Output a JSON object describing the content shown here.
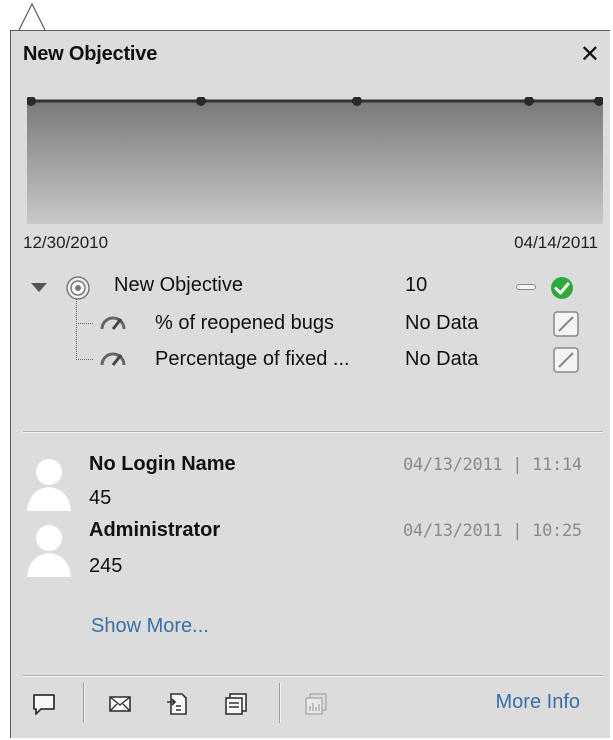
{
  "popup": {
    "title": "New Objective",
    "close_label": "✕"
  },
  "timeline": {
    "start_date": "12/30/2010",
    "end_date": "04/14/2011"
  },
  "objective": {
    "name": "New Objective",
    "value": "10",
    "status": "ok",
    "metrics": [
      {
        "name": "% of reopened bugs",
        "value": "No Data"
      },
      {
        "name": "Percentage of fixed ...",
        "value": "No Data"
      }
    ]
  },
  "activity": [
    {
      "user": "No Login Name",
      "value": "45",
      "date": "04/13/2011 | 11:14"
    },
    {
      "user": "Administrator",
      "value": "245",
      "date": "04/13/2011 | 10:25"
    }
  ],
  "show_more_label": "Show More...",
  "toolbar": {
    "more_info_label": "More Info",
    "icons": [
      "comment-icon",
      "mail-icon",
      "export-icon",
      "list-icon",
      "chart-icon"
    ]
  },
  "colors": {
    "panel_bg": "#dcdcdc",
    "link": "#3a6fa8",
    "status_ok": "#2eaa3c"
  }
}
